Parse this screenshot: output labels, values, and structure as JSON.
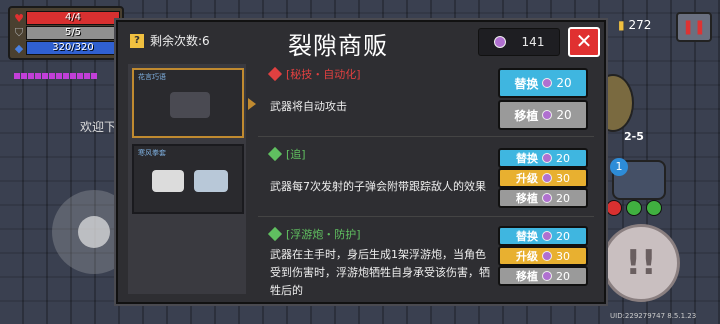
{
  "hud": {
    "hp": "4/4",
    "armor": "5/5",
    "energy": "320/320",
    "hp_color": "#d83030",
    "armor_color": "#909090",
    "energy_color": "#3060d0"
  },
  "welcome_text": "欢迎下",
  "coins": "272",
  "level": "2-5",
  "slot_number": "1",
  "uid": "UID:229279747 8.5.1.23",
  "panel": {
    "remaining_label": "剩余次数:6",
    "title": "裂隙商贩",
    "crystal_count": "141",
    "close_symbol": "✕",
    "left_cards": [
      {
        "caption": "花言巧语",
        "weapon_icon": "blaster-icon"
      },
      {
        "caption": "寒风拳套",
        "weapon_icon": "gauntlet-icon"
      }
    ],
    "entries": [
      {
        "tag": "[秘技・自动化]",
        "tag_color": "#e04040",
        "description": "武器将自动攻击",
        "buttons": [
          {
            "label": "替换",
            "price": "20",
            "kind": "swap"
          },
          {
            "label": "移植",
            "price": "20",
            "kind": "graft"
          }
        ]
      },
      {
        "tag": "[追]",
        "tag_color": "#60c060",
        "description": "武器每7次发射的子弹会附带跟踪敌人的效果",
        "buttons": [
          {
            "label": "替换",
            "price": "20",
            "kind": "swap"
          },
          {
            "label": "升级",
            "price": "30",
            "kind": "upgrade"
          },
          {
            "label": "移植",
            "price": "20",
            "kind": "graft"
          }
        ]
      },
      {
        "tag": "[浮游炮・防护]",
        "tag_color": "#60c060",
        "description": "武器在主手时，身后生成1架浮游炮，当角色受到伤害时，浮游炮牺牲自身承受该伤害，牺牲后的",
        "buttons": [
          {
            "label": "替换",
            "price": "20",
            "kind": "swap"
          },
          {
            "label": "升级",
            "price": "30",
            "kind": "upgrade"
          },
          {
            "label": "移植",
            "price": "20",
            "kind": "graft"
          }
        ]
      }
    ]
  }
}
